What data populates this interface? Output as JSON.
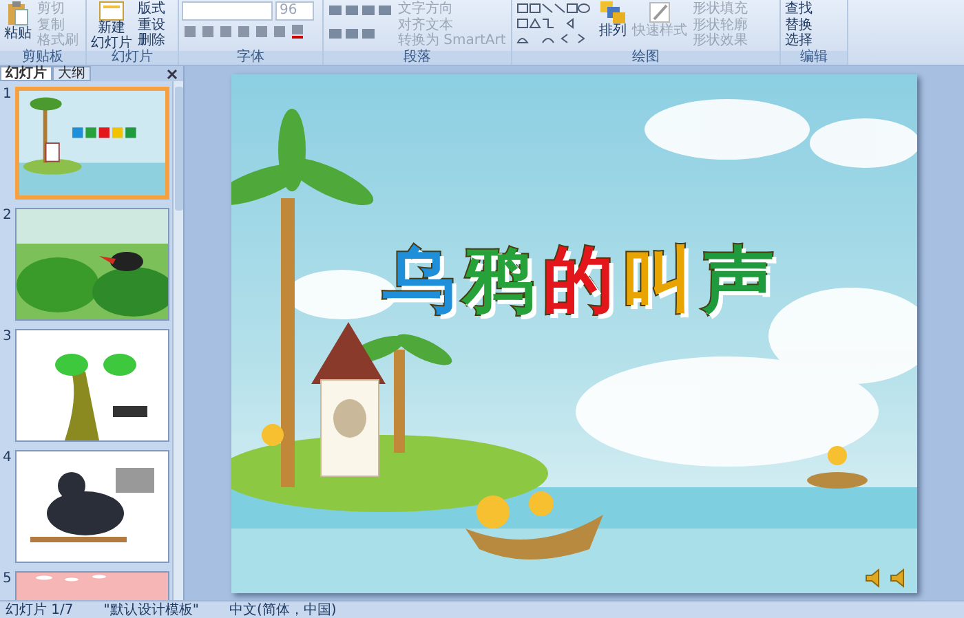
{
  "ribbon": {
    "clipboard": {
      "paste": "粘贴",
      "items": [
        {
          "label": "剪切",
          "disabled": true
        },
        {
          "label": "复制",
          "disabled": true
        },
        {
          "label": "格式刷",
          "disabled": true
        }
      ],
      "label": "剪贴板"
    },
    "slides": {
      "new_slide": [
        "新建",
        "幻灯片"
      ],
      "items": [
        "版式",
        "重设",
        "删除"
      ],
      "label": "幻灯片"
    },
    "font": {
      "size": "96",
      "label": "字体"
    },
    "paragraph": {
      "items": [
        {
          "label": "文字方向",
          "disabled": true
        },
        {
          "label": "对齐文本",
          "disabled": true
        },
        {
          "label": "转换为 SmartArt",
          "disabled": true
        }
      ],
      "label": "段落"
    },
    "drawing": {
      "arrange": "排列",
      "quick_styles": "快速样式",
      "items": [
        {
          "label": "形状填充",
          "disabled": true
        },
        {
          "label": "形状轮廓",
          "disabled": true
        },
        {
          "label": "形状效果",
          "disabled": true
        }
      ],
      "label": "绘图"
    },
    "editing": {
      "items": [
        "查找",
        "替换",
        "选择"
      ],
      "label": "编辑"
    }
  },
  "panel": {
    "tabs": [
      {
        "label": "幻灯片",
        "selected": true
      },
      {
        "label": "大纲",
        "selected": false
      }
    ],
    "thumbnails": [
      {
        "number": "1",
        "kind": "title",
        "selected": true
      },
      {
        "number": "2",
        "kind": "jungle",
        "selected": false
      },
      {
        "number": "3",
        "kind": "tree",
        "selected": false
      },
      {
        "number": "4",
        "kind": "crow",
        "selected": false
      },
      {
        "number": "5",
        "kind": "blossom",
        "selected": false
      }
    ]
  },
  "slide": {
    "title": [
      {
        "text": "乌",
        "color": "#1e8fd8"
      },
      {
        "text": "鸦",
        "color": "#27a23a"
      },
      {
        "text": "的",
        "color": "#e3161c"
      },
      {
        "text": "叫",
        "color": "#e8a400"
      },
      {
        "text": "声",
        "color": "#1f9a3c"
      }
    ]
  },
  "status_bar": [
    "幻灯片 1/7",
    "\"默认设计模板\"",
    "中文(简体，中国)"
  ]
}
